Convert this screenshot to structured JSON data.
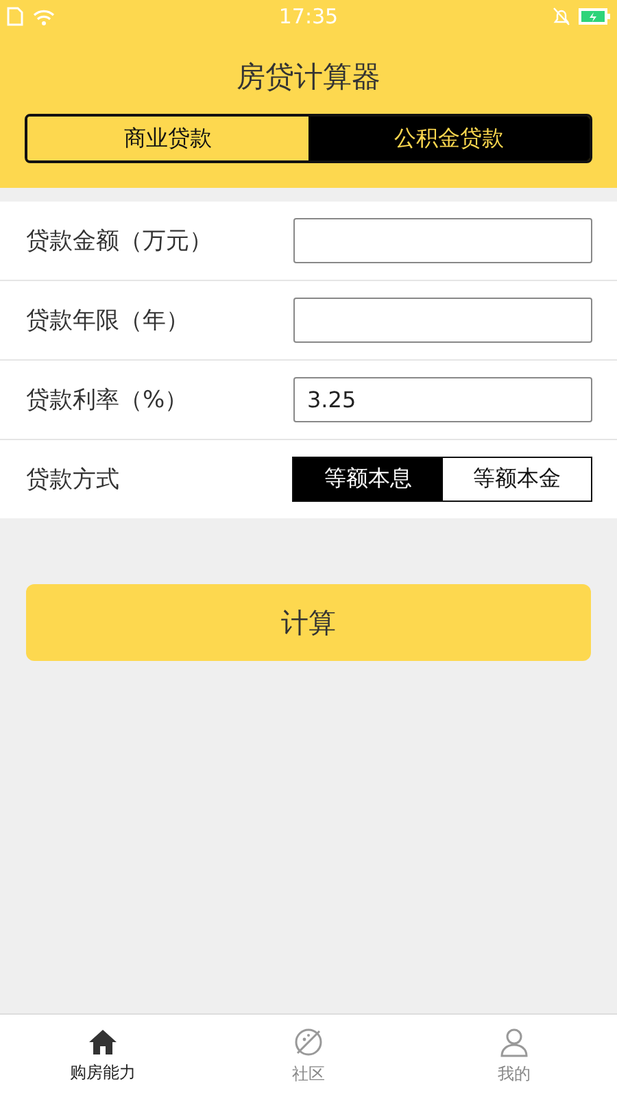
{
  "status_bar": {
    "time": "17:35"
  },
  "header": {
    "title": "房贷计算器"
  },
  "tabs": [
    {
      "label": "商业贷款",
      "selected": false
    },
    {
      "label": "公积金贷款",
      "selected": true
    }
  ],
  "form": [
    {
      "kind": "input",
      "label": "贷款金额（万元）"
    },
    {
      "kind": "input",
      "label": "贷款年限（年）"
    },
    {
      "kind": "input",
      "label": "贷款利率（%）",
      "value": "3.25"
    },
    {
      "kind": "segmented",
      "label": "贷款方式",
      "options": [
        {
          "label": "等额本息",
          "selected": true
        },
        {
          "label": "等额本金",
          "selected": false
        }
      ]
    }
  ],
  "calculate_button": "计算",
  "bottom_nav": [
    {
      "label": "购房能力",
      "kind": "home",
      "selected": true
    },
    {
      "label": "社区",
      "kind": "planet",
      "selected": false
    },
    {
      "label": "我的",
      "kind": "person",
      "selected": false
    }
  ]
}
